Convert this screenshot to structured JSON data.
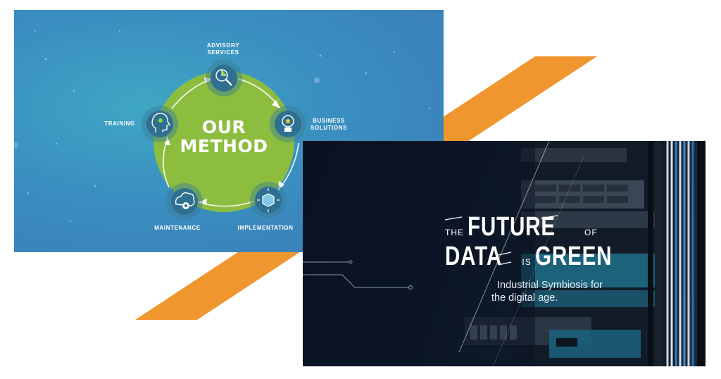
{
  "colors": {
    "stripe": "#f0962e",
    "ring": "#8cbd3f",
    "node": "#2f6f8f",
    "slide_blue": "#3a8fc0",
    "slide_dark": "#0d1a2c"
  },
  "method_slide": {
    "title_line1": "OUR",
    "title_line2": "METHOD",
    "nodes": [
      {
        "label": "ADVISORY\nSERVICES",
        "icon": "pie-chart-magnifier-icon"
      },
      {
        "label": "BUSINESS\nSOLUTIONS",
        "icon": "lightbulb-gear-icon"
      },
      {
        "label": "IMPLEMENTATION",
        "icon": "cube-arrows-icon"
      },
      {
        "label": "MAINTENANCE",
        "icon": "cloud-gear-icon"
      },
      {
        "label": "TRAINING",
        "icon": "head-gear-icon"
      }
    ]
  },
  "data_slide": {
    "word_the": "THE",
    "word_future": "FUTURE",
    "word_of": "OF",
    "word_data": "DATA",
    "word_is": "IS",
    "word_green": "GREEN",
    "subtitle_line1": "Industrial Symbiosis for",
    "subtitle_line2": "the digital age."
  }
}
